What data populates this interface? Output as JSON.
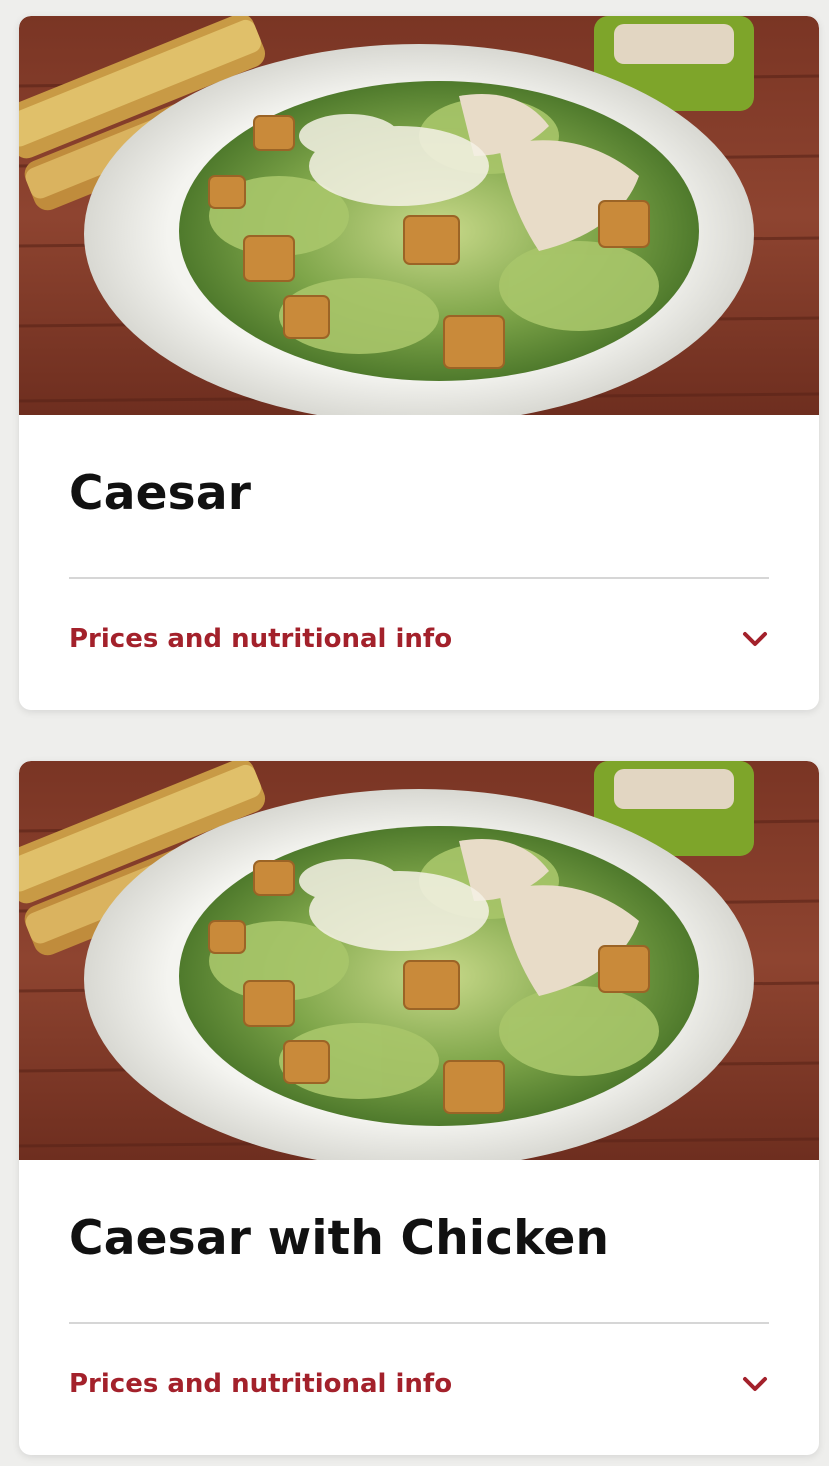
{
  "menu_items": [
    {
      "title": "Caesar",
      "info_label": "Prices and nutritional info",
      "image_alt": "caesar-salad-photo"
    },
    {
      "title": "Caesar with Chicken",
      "info_label": "Prices and nutritional info",
      "image_alt": "caesar-salad-with-chicken-photo"
    }
  ],
  "icons": {
    "expand": "chevron-down-icon"
  },
  "colors": {
    "accent": "#a3212b",
    "title": "#111111",
    "card_bg": "#ffffff",
    "page_bg": "#eeeeec"
  }
}
